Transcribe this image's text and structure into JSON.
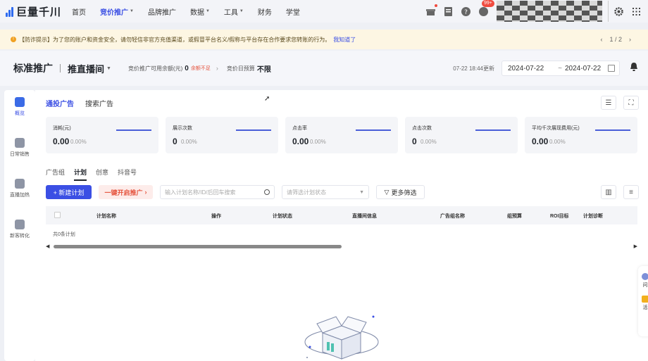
{
  "app": {
    "logo_text": "巨量千川"
  },
  "nav": {
    "items": [
      {
        "label": "首页",
        "active": false,
        "dropdown": false
      },
      {
        "label": "竞价推广",
        "active": true,
        "dropdown": true
      },
      {
        "label": "品牌推广",
        "active": false,
        "dropdown": false
      },
      {
        "label": "数据",
        "active": false,
        "dropdown": true
      },
      {
        "label": "工具",
        "active": false,
        "dropdown": true
      },
      {
        "label": "财务",
        "active": false,
        "dropdown": false
      },
      {
        "label": "学堂",
        "active": false,
        "dropdown": false
      }
    ],
    "icons": [
      "gift-icon",
      "document-icon",
      "help-icon",
      "message-icon",
      "settings-icon",
      "grid-apps-icon"
    ],
    "message_badge": "99+"
  },
  "notice": {
    "text": "【防诈提示】为了您的账户和资金安全，请勿轻信非官方充值渠道，或假冒平台名义/假称与平台存在合作要求您转账的行为。",
    "link": "我知道了",
    "pager": "1 / 2"
  },
  "subheader": {
    "title": "标准推广",
    "title2": "推直播间",
    "balance_label": "竞价推广可用余额(元)",
    "balance_value": "0",
    "balance_warn": "余额不足",
    "budget_label": "竞价日预算",
    "budget_value": "不限",
    "date_note": "07-22 18:44更新",
    "date_start": "2024-07-22",
    "date_end": "2024-07-22"
  },
  "sidebar": {
    "items": [
      {
        "label": "概览",
        "active": true
      },
      {
        "label": "日常销售",
        "active": false
      },
      {
        "label": "直播加热",
        "active": false
      },
      {
        "label": "新客转化",
        "active": false
      }
    ]
  },
  "main": {
    "tabs": [
      {
        "label": "通投广告",
        "active": true
      },
      {
        "label": "搜索广告",
        "active": false
      }
    ],
    "metrics": [
      {
        "label": "消耗(元)",
        "value": "0.00",
        "pct": "0.00%"
      },
      {
        "label": "展示次数",
        "value": "0",
        "pct": "0.00%"
      },
      {
        "label": "点击率",
        "value": "0.00",
        "pct": "0.00%"
      },
      {
        "label": "点击次数",
        "value": "0",
        "pct": "0.00%"
      },
      {
        "label": "平均千次展现费用(元)",
        "value": "0.00",
        "pct": "0.00%"
      }
    ],
    "subtabs": [
      {
        "label": "广告组",
        "active": false
      },
      {
        "label": "计划",
        "active": true
      },
      {
        "label": "创意",
        "active": false
      },
      {
        "label": "抖音号",
        "active": false
      }
    ],
    "toolbar": {
      "new_plan": "+ 新建计划",
      "quick_start": "一键开启推广",
      "search_placeholder": "输入计划名称/ID/后回车搜索",
      "status_placeholder": "请筛选计划状态",
      "more_filter": "更多筛选"
    },
    "table": {
      "columns": [
        "计划名称",
        "操作",
        "计划状态",
        "直播间信息",
        "广告组名称",
        "组预算",
        "ROI目标",
        "计划诊断"
      ],
      "total": "共0条计划"
    }
  },
  "float_panel": {
    "items": [
      "问",
      "活"
    ]
  },
  "colors": {
    "accent": "#3b4fe4",
    "warning": "#e5533d",
    "notice_bg": "#fdf6e3"
  }
}
